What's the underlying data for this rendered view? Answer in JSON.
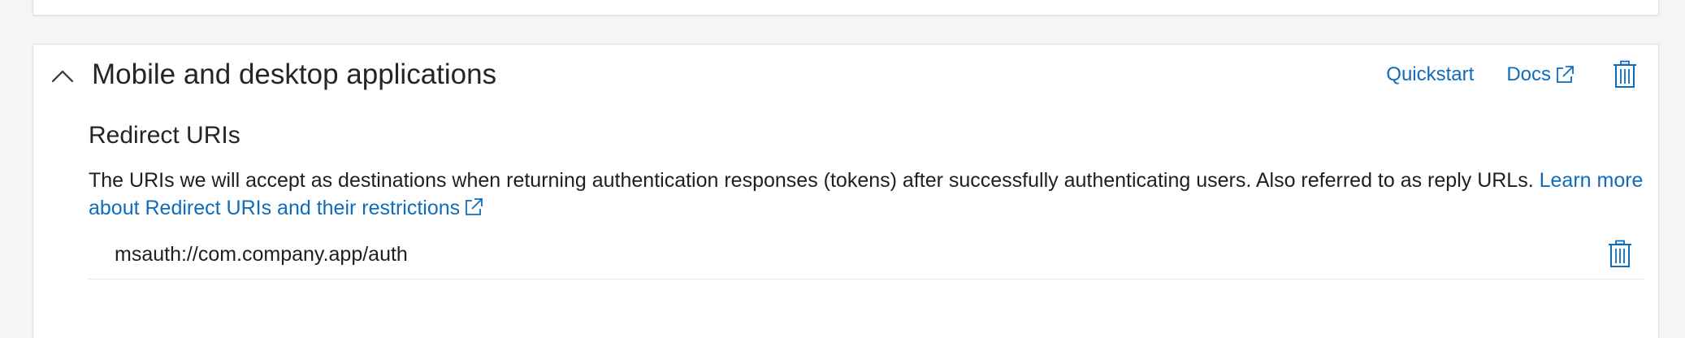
{
  "section": {
    "title": "Mobile and desktop applications",
    "quickstart_label": "Quickstart",
    "docs_label": "Docs"
  },
  "redirect": {
    "heading": "Redirect URIs",
    "description": "The URIs we will accept as destinations when returning authentication responses (tokens) after successfully authenticating users. Also referred to as reply URLs. ",
    "learn_more_label": "Learn more about Redirect URIs and their restrictions",
    "uris": [
      "msauth://com.company.app/auth"
    ]
  },
  "icons": {
    "collapse": "chevron-up-icon",
    "external": "external-link-icon",
    "delete": "trash-icon"
  },
  "colors": {
    "link": "#0f6cbd",
    "text": "#1f1f1f",
    "border": "#e1e1e1"
  }
}
